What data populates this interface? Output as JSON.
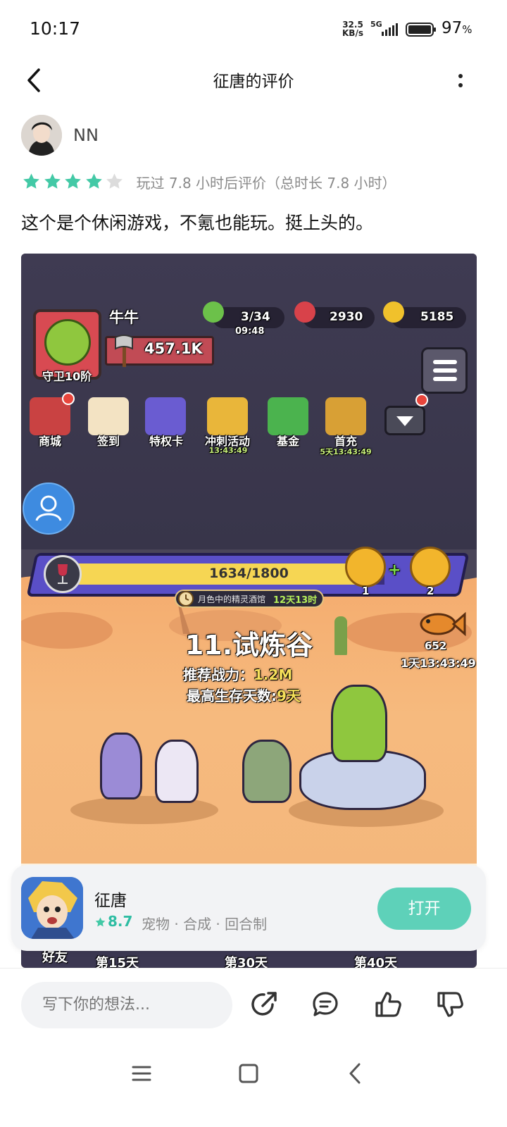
{
  "status_bar": {
    "time": "10:17",
    "net_speed_value": "32.5",
    "net_speed_unit": "KB/s",
    "network": "5G",
    "battery": "97",
    "battery_unit": "%"
  },
  "header": {
    "title": "征唐的评价",
    "back_icon": "chevron-left-icon",
    "more_icon": "more-vertical-icon"
  },
  "review": {
    "username": "NN",
    "rating": 4,
    "rating_max": 5,
    "play_info": "玩过 7.8 小时后评价（总时长 7.8 小时）",
    "text": "这个是个休闲游戏，不氪也能玩。挺上头的。"
  },
  "screenshot": {
    "player_name": "牛牛",
    "guard_rank": "守卫10阶",
    "power": "457.1K",
    "stamina": "3/34",
    "stamina_timer": "09:48",
    "gems": "2930",
    "gold": "5185",
    "features": [
      {
        "label": "商城",
        "timer": ""
      },
      {
        "label": "签到",
        "timer": ""
      },
      {
        "label": "特权卡",
        "timer": ""
      },
      {
        "label": "冲刺活动",
        "timer": "13:43:49"
      },
      {
        "label": "基金",
        "timer": ""
      },
      {
        "label": "首充",
        "timer": "5天13:43:49"
      }
    ],
    "progress_text": "1634/1800",
    "progress_value": 0.908,
    "chest_1": "1",
    "chest_2": "2",
    "tavern_name": "月色中的精灵酒馆",
    "tavern_time": "12天13时",
    "stage_title": "11.试炼谷",
    "fish_count": "652",
    "fish_timer": "1天13:43:49",
    "rec_power_label": "推荐战力：",
    "rec_power_value": "1.2M",
    "max_days_label": "最高生存天数:",
    "max_days_value": "9天",
    "friend_label": "好友",
    "day_labels": [
      "第15天",
      "第30天",
      "第40天"
    ]
  },
  "app_card": {
    "name": "征唐",
    "score": "8.7",
    "tags": "宠物 · 合成 · 回合制",
    "open_label": "打开"
  },
  "bottom_bar": {
    "comment_placeholder": "写下你的想法..."
  },
  "colors": {
    "accent": "#5ed1b9",
    "star_filled": "#43c9a6",
    "star_empty": "#dcdcdc",
    "score": "#2ebda3"
  }
}
